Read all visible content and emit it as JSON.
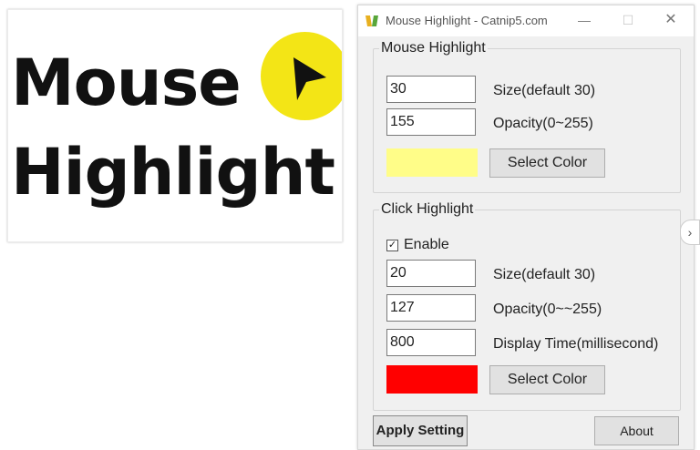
{
  "promo": {
    "line1": "Mouse",
    "line2": "Highlight",
    "circle_color": "#f3e516"
  },
  "window": {
    "title": "Mouse Highlight - Catnip5.com",
    "icon": "catnip-app-icon",
    "minimize_symbol": "—",
    "maximize_symbol": "☐",
    "close_symbol": "✕"
  },
  "mouse_highlight": {
    "legend": "Mouse Highlight",
    "size_value": "30",
    "size_label": "Size(default 30)",
    "opacity_value": "155",
    "opacity_label": "Opacity(0~255)",
    "color": "#fffd88",
    "select_color_label": "Select Color"
  },
  "click_highlight": {
    "legend": "Click Highlight",
    "enable_label": "Enable",
    "enable_checked": true,
    "size_value": "20",
    "size_label": "Size(default 30)",
    "opacity_value": "127",
    "opacity_label": "Opacity(0~~255)",
    "time_value": "800",
    "time_label": "Display Time(millisecond)",
    "color": "#ff0000",
    "select_color_label": "Select Color"
  },
  "footer": {
    "apply_label": "Apply Setting",
    "about_label": "About"
  },
  "scroll_arrow_symbol": "›"
}
